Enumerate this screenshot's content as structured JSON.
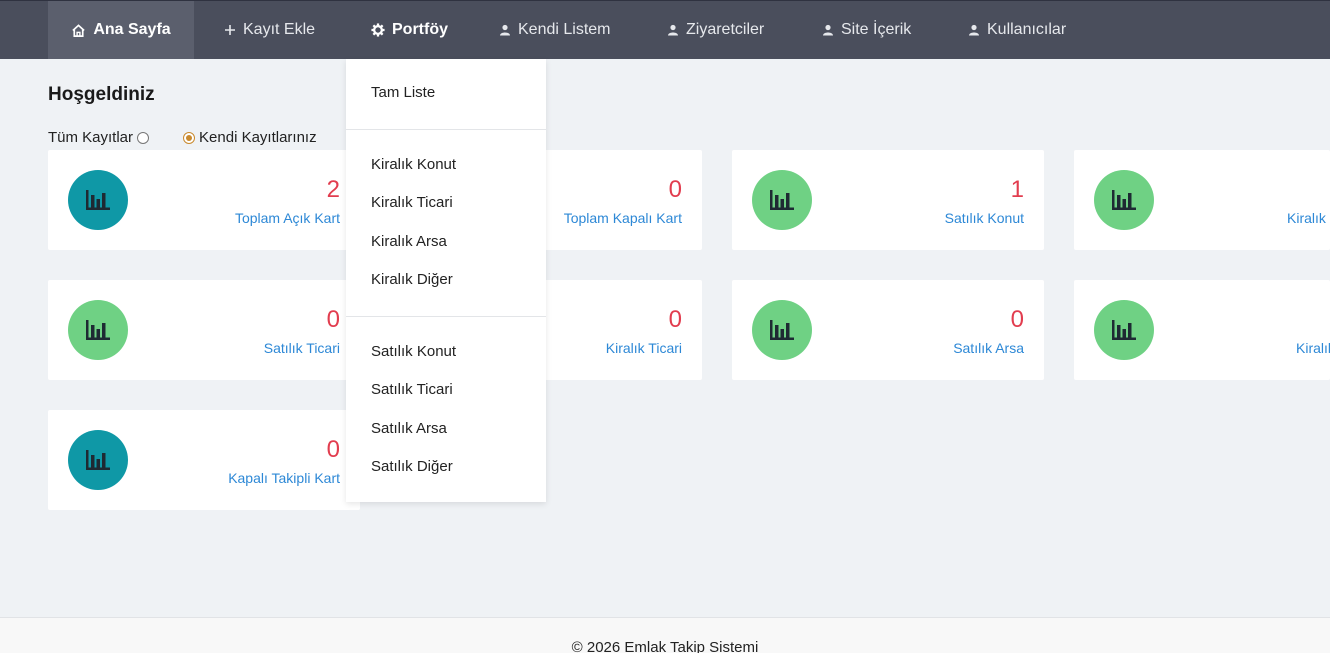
{
  "nav": {
    "items": [
      {
        "label": "Ana Sayfa",
        "icon": "home-icon"
      },
      {
        "label": "Kayıt Ekle",
        "icon": "plus-icon"
      },
      {
        "label": "Portföy",
        "icon": "gear-icon"
      },
      {
        "label": "Kendi Listem",
        "icon": "user-icon"
      },
      {
        "label": "Ziyaretciler",
        "icon": "user-icon"
      },
      {
        "label": "Site İçerik",
        "icon": "user-icon"
      },
      {
        "label": "Kullanıcılar",
        "icon": "user-icon"
      }
    ],
    "active": "Ana Sayfa",
    "open": "Portföy"
  },
  "welcome": "Hoşgeldiniz",
  "filters": {
    "all_label": "Tüm Kayıtlar",
    "own_label": "Kendi Kayıtlarınız",
    "selected": "Kendi Kayıtlarınız"
  },
  "cards": [
    {
      "value": "2",
      "label": "Toplam Açık Kart",
      "icon_color": "#0f98a6"
    },
    {
      "value": "0",
      "label": "Toplam Kapalı Kart",
      "icon_color": "#6fd184"
    },
    {
      "value": "1",
      "label": "Satılık Konut",
      "icon_color": "#6fd184"
    },
    {
      "value": "",
      "label": "Kiralık",
      "icon_color": "#6fd184"
    },
    {
      "value": "0",
      "label": "Satılık Ticari",
      "icon_color": "#6fd184"
    },
    {
      "value": "0",
      "label": "Kiralık Ticari",
      "icon_color": "#6fd184"
    },
    {
      "value": "0",
      "label": "Satılık Arsa",
      "icon_color": "#6fd184"
    },
    {
      "value": "",
      "label": "Kiralık",
      "icon_color": "#6fd184"
    },
    {
      "value": "0",
      "label": "Kapalı Takipli Kart",
      "icon_color": "#0f98a6"
    }
  ],
  "dropdown": {
    "groups": [
      [
        "Tam Liste"
      ],
      [
        "Kiralık Konut",
        "Kiralık Ticari",
        "Kiralık Arsa",
        "Kiralık Diğer"
      ],
      [
        "Satılık Konut",
        "Satılık Ticari",
        "Satılık Arsa",
        "Satılık Diğer"
      ]
    ]
  },
  "footer": "© 2026 Emlak Takip Sistemi",
  "colors": {
    "navbar": "#4a4e5c",
    "nav_active": "#5b5f6d",
    "value_red": "#e23d4f",
    "label_blue": "#2d88d6",
    "icon_teal": "#0f98a6",
    "icon_green": "#6fd184"
  }
}
